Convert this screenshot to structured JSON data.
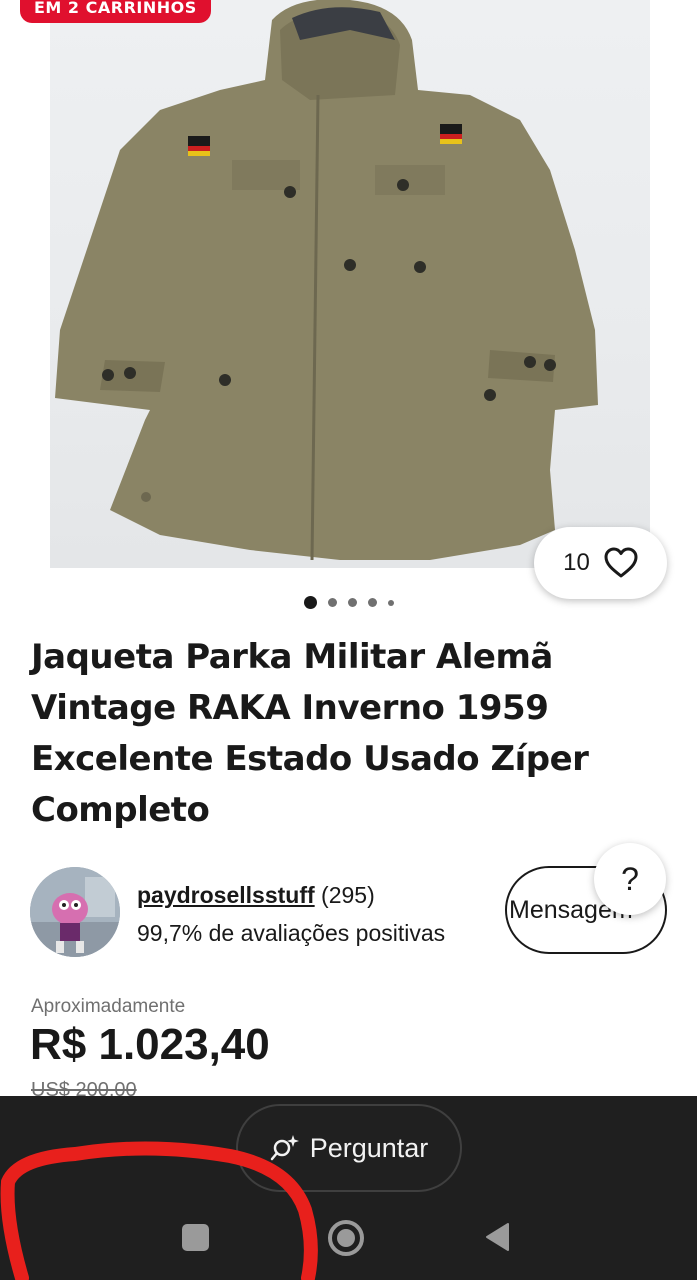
{
  "gallery": {
    "cart_badge": "EM 2 CARRINHOS",
    "watch_count": "10",
    "image_index": 1,
    "image_total": 5
  },
  "listing": {
    "title": "Jaqueta Parka Militar Alemã Vintage RAKA Inverno 1959 Excelente Estado Usado Zíper Completo"
  },
  "seller": {
    "name": "paydrosellsstuff",
    "feedback_count": "(295)",
    "positive": "99,7% de avaliações positivas",
    "message_button": "Mensagem",
    "help": "?"
  },
  "price": {
    "approx_label": "Aproximadamente",
    "value": "R$ 1.023,40",
    "original": "US$ 200,00"
  },
  "bottom": {
    "ask_button": "Perguntar"
  },
  "colors": {
    "badge": "#e0102e",
    "text": "#191919",
    "bottom_bar": "#1f1f1f",
    "annotation": "#e8201c"
  }
}
